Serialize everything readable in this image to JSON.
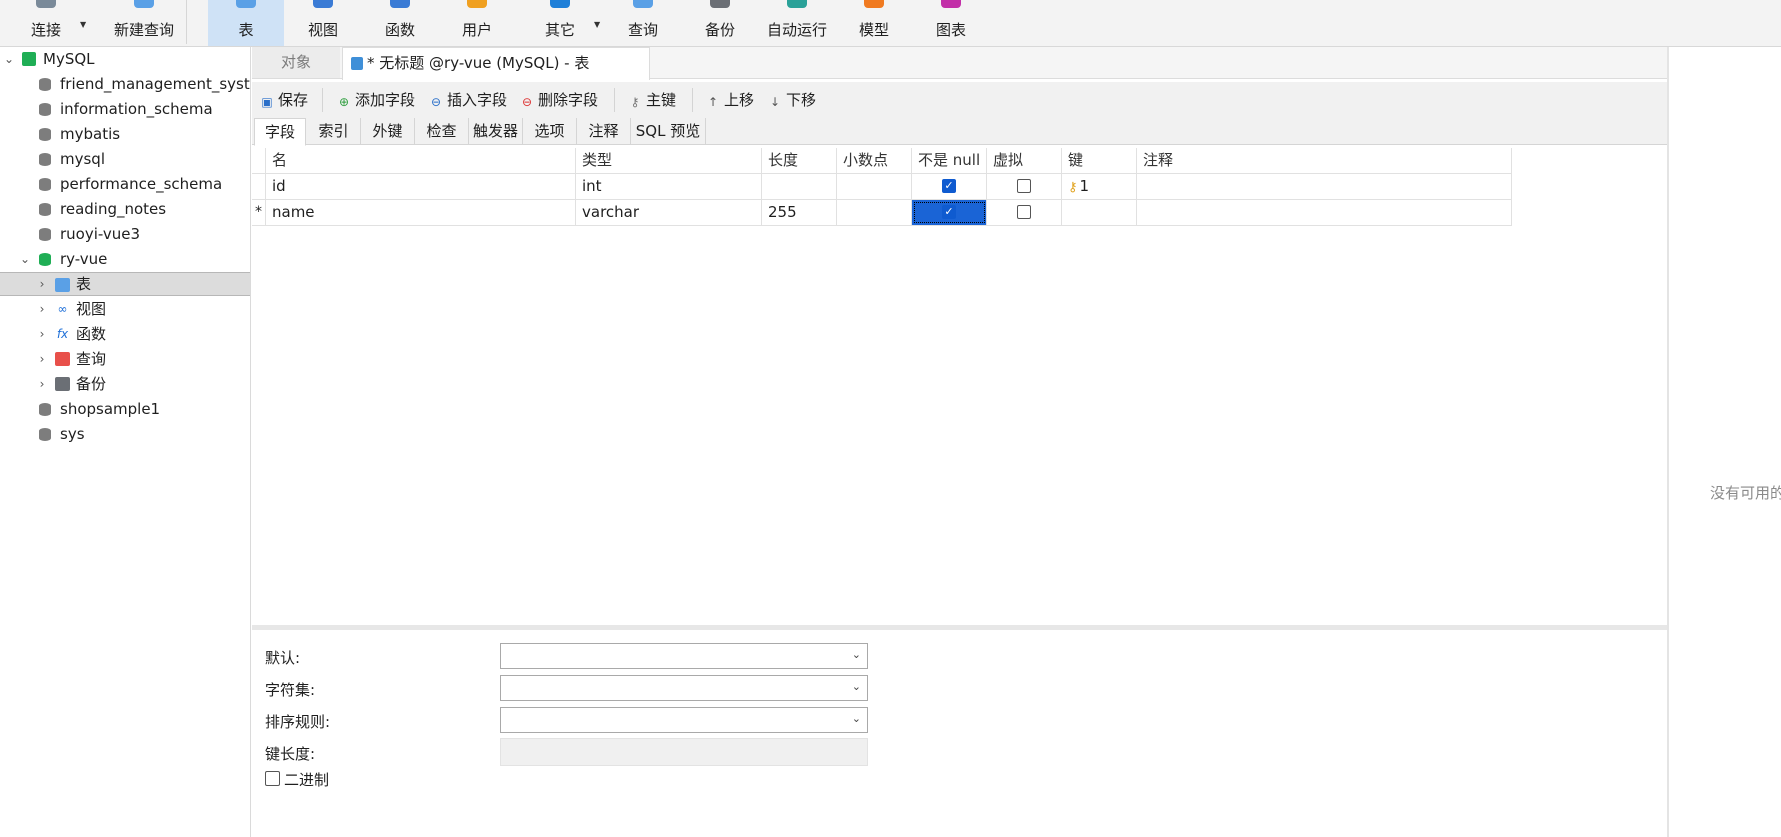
{
  "toolbar": {
    "items": [
      {
        "label": "连接",
        "icon": "connect-icon"
      },
      {
        "label": "新建查询",
        "icon": "new-query-icon"
      },
      {
        "label": "表",
        "icon": "table-icon"
      },
      {
        "label": "视图",
        "icon": "view-icon"
      },
      {
        "label": "函数",
        "icon": "function-icon"
      },
      {
        "label": "用户",
        "icon": "user-icon"
      },
      {
        "label": "其它",
        "icon": "others-icon"
      },
      {
        "label": "查询",
        "icon": "query-icon"
      },
      {
        "label": "备份",
        "icon": "backup-icon"
      },
      {
        "label": "自动运行",
        "icon": "automation-icon"
      },
      {
        "label": "模型",
        "icon": "model-icon"
      },
      {
        "label": "图表",
        "icon": "chart-icon"
      }
    ]
  },
  "sidebar": {
    "connection": "MySQL",
    "databases": [
      "friend_management_syste",
      "information_schema",
      "mybatis",
      "mysql",
      "performance_schema",
      "reading_notes",
      "ruoyi-vue3",
      "ry-vue",
      "shopsample1",
      "sys"
    ],
    "expanded_db": "ry-vue",
    "children": [
      "表",
      "视图",
      "函数",
      "查询",
      "备份"
    ],
    "selected_child": "表"
  },
  "tabs": {
    "objects": "对象",
    "document": "* 无标题 @ry-vue (MySQL) - 表"
  },
  "editor_toolbar": {
    "save": "保存",
    "add_field": "添加字段",
    "insert_field": "插入字段",
    "delete_field": "删除字段",
    "primary_key": "主键",
    "move_up": "上移",
    "move_down": "下移"
  },
  "subtabs": [
    "字段",
    "索引",
    "外键",
    "检查",
    "触发器",
    "选项",
    "注释",
    "SQL 预览"
  ],
  "grid": {
    "columns": [
      "名",
      "类型",
      "长度",
      "小数点",
      "不是 null",
      "虚拟",
      "键",
      "注释"
    ],
    "rows": [
      {
        "marker": "",
        "name": "id",
        "type": "int",
        "length": "",
        "decimals": "",
        "not_null": true,
        "virtual": false,
        "key": "1",
        "comment": ""
      },
      {
        "marker": "*",
        "name": "name",
        "type": "varchar",
        "length": "255",
        "decimals": "",
        "not_null": true,
        "virtual": false,
        "key": "",
        "comment": ""
      }
    ]
  },
  "properties": {
    "default_label": "默认:",
    "charset_label": "字符集:",
    "collation_label": "排序规则:",
    "key_length_label": "键长度:",
    "binary_label": "二进制"
  },
  "right_panel": {
    "text": "没有可用的"
  },
  "colors": {
    "accent": "#1a64d6",
    "selected_toolbar": "#cfe2f6",
    "db_green": "#1fae55"
  }
}
